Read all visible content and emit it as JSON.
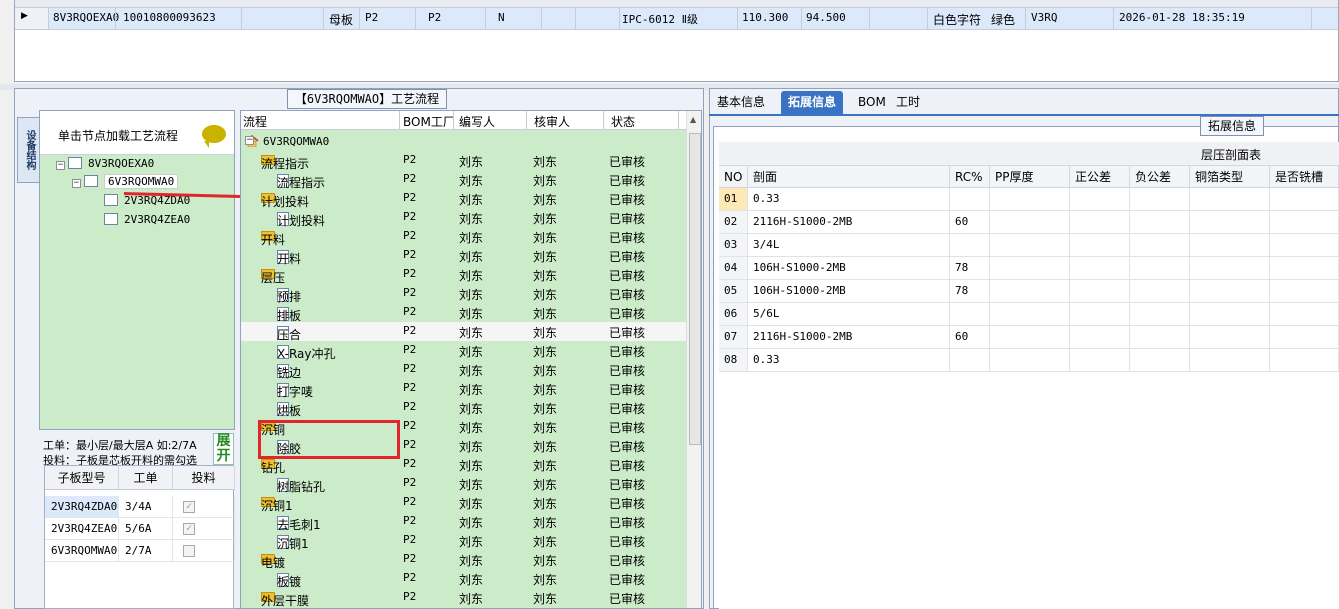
{
  "top_row": {
    "code": "8V3RQOEXA0",
    "order_no": "10010800093623",
    "board_type": "母板",
    "plant1": "P2",
    "plant2": "P2",
    "flag": "N",
    "grade": "IPC-6012 Ⅱ级",
    "length": "110.300",
    "width": "94.500",
    "silkscreen": "白色字符",
    "soldermask": "绿色",
    "version": "V3RQ",
    "datetime": "2026-01-28 18:35:19"
  },
  "left_panel": {
    "title": "【6V3RQOMWAO】工艺流程",
    "vertical_tab": "设备结构",
    "tree_hint": "单击节点加载工艺流程",
    "tree": [
      {
        "label": "8V3RQOEXA0",
        "level": 0,
        "expander": "−"
      },
      {
        "label": "6V3RQOMWA0",
        "level": 1,
        "expander": "−",
        "selected": true
      },
      {
        "label": "2V3RQ4ZDA0",
        "level": 2
      },
      {
        "label": "2V3RQ4ZEA0",
        "level": 2
      }
    ],
    "info_line1": "工单：最小层/最大层A 如:2/7A",
    "info_line2": "投料：子板是芯板开料的需勾选",
    "expand_button": "展开",
    "sub_table": {
      "headers": [
        "子板型号",
        "工单",
        "投料"
      ],
      "rows": [
        {
          "model": "2V3RQ4ZDA0",
          "order": "3/4A",
          "feed": true
        },
        {
          "model": "2V3RQ4ZEA0",
          "order": "5/6A",
          "feed": true
        },
        {
          "model": "6V3RQOMWA0",
          "order": "2/7A",
          "feed": false
        }
      ]
    }
  },
  "process": {
    "headers": [
      "流程",
      "BOM工厂",
      "编写人",
      "核审人",
      "状态"
    ],
    "root": "6V3RQOMWA0",
    "rows": [
      {
        "name": "流程指示",
        "type": "folder",
        "plant": "P2",
        "writer": "刘东",
        "checker": "刘东",
        "status": "已审核"
      },
      {
        "name": "流程指示",
        "type": "doc",
        "plant": "P2",
        "writer": "刘东",
        "checker": "刘东",
        "status": "已审核"
      },
      {
        "name": "计划投料",
        "type": "folder",
        "plant": "P2",
        "writer": "刘东",
        "checker": "刘东",
        "status": "已审核"
      },
      {
        "name": "计划投料",
        "type": "doc",
        "plant": "P2",
        "writer": "刘东",
        "checker": "刘东",
        "status": "已审核"
      },
      {
        "name": "开料",
        "type": "folder",
        "plant": "P2",
        "writer": "刘东",
        "checker": "刘东",
        "status": "已审核"
      },
      {
        "name": "开料",
        "type": "doc",
        "plant": "P2",
        "writer": "刘东",
        "checker": "刘东",
        "status": "已审核"
      },
      {
        "name": "层压",
        "type": "folder",
        "plant": "P2",
        "writer": "刘东",
        "checker": "刘东",
        "status": "已审核"
      },
      {
        "name": "预排",
        "type": "doc",
        "plant": "P2",
        "writer": "刘东",
        "checker": "刘东",
        "status": "已审核"
      },
      {
        "name": "排板",
        "type": "doc",
        "plant": "P2",
        "writer": "刘东",
        "checker": "刘东",
        "status": "已审核"
      },
      {
        "name": "压合",
        "type": "doc",
        "plant": "P2",
        "writer": "刘东",
        "checker": "刘东",
        "status": "已审核",
        "highlight": true
      },
      {
        "name": "X-Ray冲孔",
        "type": "doc",
        "plant": "P2",
        "writer": "刘东",
        "checker": "刘东",
        "status": "已审核"
      },
      {
        "name": "铣边",
        "type": "doc",
        "plant": "P2",
        "writer": "刘东",
        "checker": "刘东",
        "status": "已审核"
      },
      {
        "name": "打字唛",
        "type": "doc",
        "plant": "P2",
        "writer": "刘东",
        "checker": "刘东",
        "status": "已审核"
      },
      {
        "name": "烘板",
        "type": "doc",
        "plant": "P2",
        "writer": "刘东",
        "checker": "刘东",
        "status": "已审核"
      },
      {
        "name": "沉铜",
        "type": "folder",
        "plant": "P2",
        "writer": "刘东",
        "checker": "刘东",
        "status": "已审核"
      },
      {
        "name": "除胶",
        "type": "doc",
        "plant": "P2",
        "writer": "刘东",
        "checker": "刘东",
        "status": "已审核"
      },
      {
        "name": "钻孔",
        "type": "folder",
        "plant": "P2",
        "writer": "刘东",
        "checker": "刘东",
        "status": "已审核"
      },
      {
        "name": "树脂钻孔",
        "type": "doc",
        "plant": "P2",
        "writer": "刘东",
        "checker": "刘东",
        "status": "已审核"
      },
      {
        "name": "沉铜1",
        "type": "folder",
        "plant": "P2",
        "writer": "刘东",
        "checker": "刘东",
        "status": "已审核"
      },
      {
        "name": "去毛刺1",
        "type": "doc",
        "plant": "P2",
        "writer": "刘东",
        "checker": "刘东",
        "status": "已审核"
      },
      {
        "name": "沉铜1",
        "type": "doc",
        "plant": "P2",
        "writer": "刘东",
        "checker": "刘东",
        "status": "已审核"
      },
      {
        "name": "电镀",
        "type": "folder",
        "plant": "P2",
        "writer": "刘东",
        "checker": "刘东",
        "status": "已审核"
      },
      {
        "name": "板镀",
        "type": "doc",
        "plant": "P2",
        "writer": "刘东",
        "checker": "刘东",
        "status": "已审核"
      },
      {
        "name": "外层干膜",
        "type": "folder",
        "plant": "P2",
        "writer": "刘东",
        "checker": "刘东",
        "status": "已审核"
      }
    ]
  },
  "right_panel": {
    "tabs": [
      "基本信息",
      "拓展信息",
      "BOM",
      "工时"
    ],
    "active_tab": "拓展信息",
    "group_title": "拓展信息",
    "table_caption": "层压剖面表",
    "headers": [
      "NO",
      "剖面",
      "RC%",
      "PP厚度",
      "正公差",
      "负公差",
      "铜箔类型",
      "是否铣槽"
    ],
    "rows": [
      {
        "no": "01",
        "section": "0.33",
        "rc": ""
      },
      {
        "no": "02",
        "section": "2116H-S1000-2MB",
        "rc": "60"
      },
      {
        "no": "03",
        "section": "3/4L",
        "rc": ""
      },
      {
        "no": "04",
        "section": "106H-S1000-2MB",
        "rc": "78"
      },
      {
        "no": "05",
        "section": "106H-S1000-2MB",
        "rc": "78"
      },
      {
        "no": "06",
        "section": "5/6L",
        "rc": ""
      },
      {
        "no": "07",
        "section": "2116H-S1000-2MB",
        "rc": "60"
      },
      {
        "no": "08",
        "section": "0.33",
        "rc": ""
      }
    ]
  },
  "colors": {
    "tree_bg": "#ccebc9",
    "accent": "#3a73c4",
    "annotation": "#e0262b"
  }
}
